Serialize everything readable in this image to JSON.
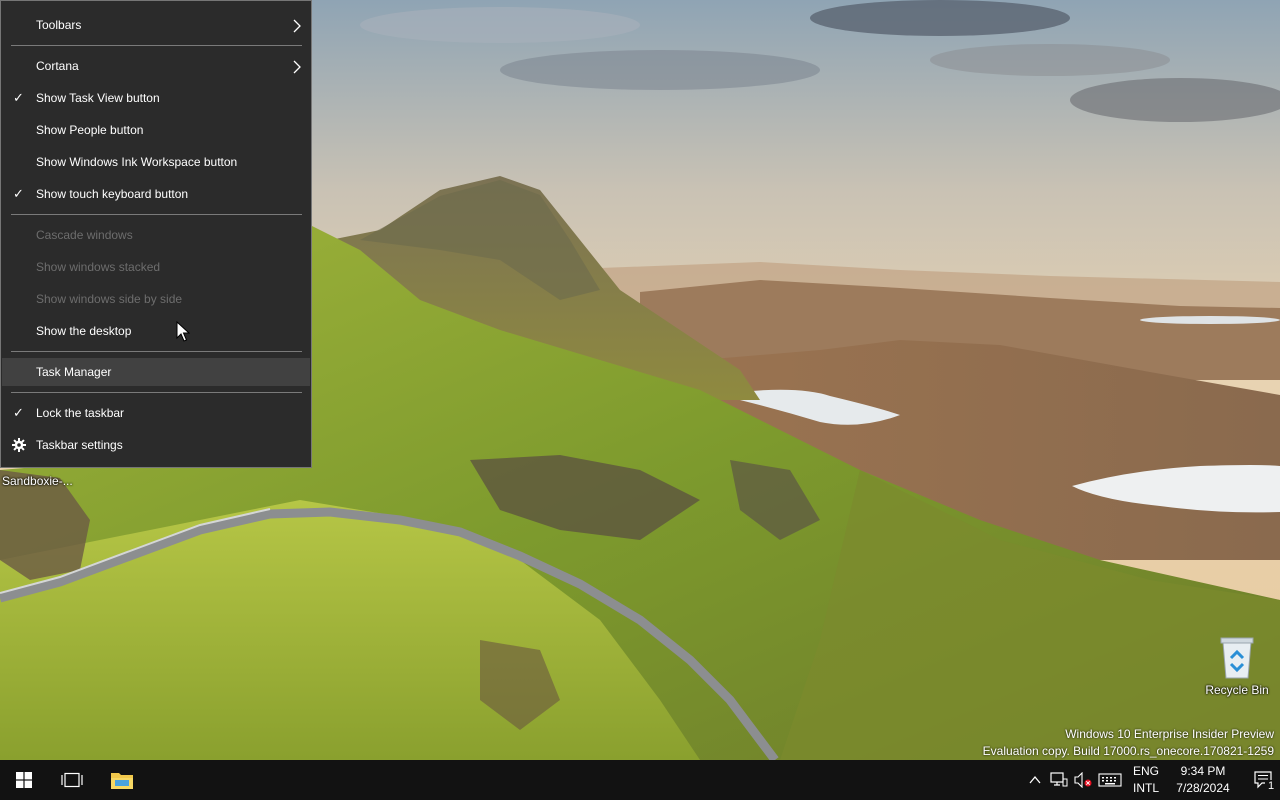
{
  "context_menu": {
    "items": [
      {
        "label": "Toolbars",
        "has_submenu": true,
        "checked": false,
        "enabled": true
      },
      {
        "label": "Cortana",
        "has_submenu": true,
        "checked": false,
        "enabled": true
      },
      {
        "label": "Show Task View button",
        "checked": true,
        "enabled": true
      },
      {
        "label": "Show People button",
        "checked": false,
        "enabled": true
      },
      {
        "label": "Show Windows Ink Workspace button",
        "checked": false,
        "enabled": true
      },
      {
        "label": "Show touch keyboard button",
        "checked": true,
        "enabled": true
      },
      {
        "label": "Cascade windows",
        "checked": false,
        "enabled": false
      },
      {
        "label": "Show windows stacked",
        "checked": false,
        "enabled": false
      },
      {
        "label": "Show windows side by side",
        "checked": false,
        "enabled": false
      },
      {
        "label": "Show the desktop",
        "checked": false,
        "enabled": true
      },
      {
        "label": "Task Manager",
        "checked": false,
        "enabled": true,
        "highlighted": true
      },
      {
        "label": "Lock the taskbar",
        "checked": true,
        "enabled": true
      },
      {
        "label": "Taskbar settings",
        "checked": false,
        "enabled": true,
        "icon": "gear-icon"
      }
    ],
    "checkmark": "✓"
  },
  "desktop": {
    "sandboxie_label": "Sandboxie-...",
    "recycle_bin_label": "Recycle Bin",
    "watermark": {
      "line1": "Windows 10 Enterprise Insider Preview",
      "line2": "Evaluation copy. Build 17000.rs_onecore.170821-1259"
    }
  },
  "taskbar": {
    "start_icon": "windows-logo-icon",
    "taskview_icon": "task-view-icon",
    "explorer_icon": "file-explorer-icon",
    "tray": {
      "chevron_icon": "chevron-up-icon",
      "network_icon": "network-icon",
      "volume_icon": "volume-muted-icon",
      "keyboard_icon": "touch-keyboard-icon",
      "language_top": "ENG",
      "language_bottom": "INTL",
      "time": "9:34 PM",
      "date": "7/28/2024",
      "notification_count": "1",
      "notification_icon": "action-center-icon"
    }
  },
  "colors": {
    "menu_bg": "#2b2b2b",
    "menu_hover": "#414141",
    "menu_disabled_text": "#6d6d6d",
    "taskbar_bg": "#121212"
  }
}
